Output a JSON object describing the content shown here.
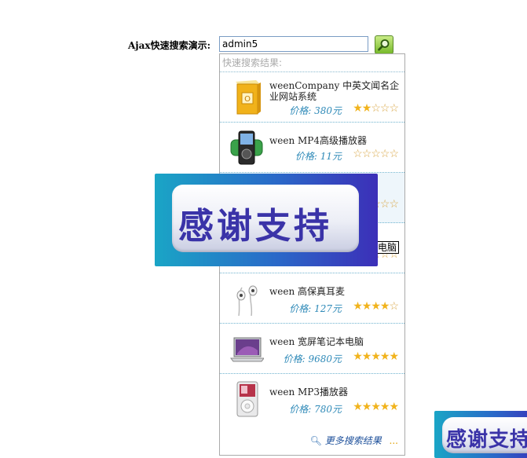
{
  "search": {
    "label": "Ajax快速搜索演示:",
    "value": "admin5"
  },
  "suggest": {
    "header": "快速搜索结果:",
    "items": [
      {
        "name": "weenCompany 中英文闻名企业网站系统",
        "price": "价格: 380元",
        "rating": 2
      },
      {
        "name": "ween MP4高级播放器",
        "price": "价格: 11元",
        "rating": 0
      },
      {
        "name": "",
        "price": "",
        "rating": 0
      },
      {
        "name": "",
        "price": "",
        "rating": 0
      },
      {
        "name": "ween 高保真耳麦",
        "price": "价格: 127元",
        "rating": 4
      },
      {
        "name": "ween 宽屏笔记本电脑",
        "price": "价格: 9680元",
        "rating": 5
      },
      {
        "name": "ween MP3播放器",
        "price": "价格: 780元",
        "rating": 5
      }
    ],
    "more": "更多搜索结果",
    "more_dots": "..."
  },
  "tooltip": "本电脑",
  "banners": [
    {
      "text": "感谢支持"
    },
    {
      "text": "感谢支持"
    }
  ]
}
